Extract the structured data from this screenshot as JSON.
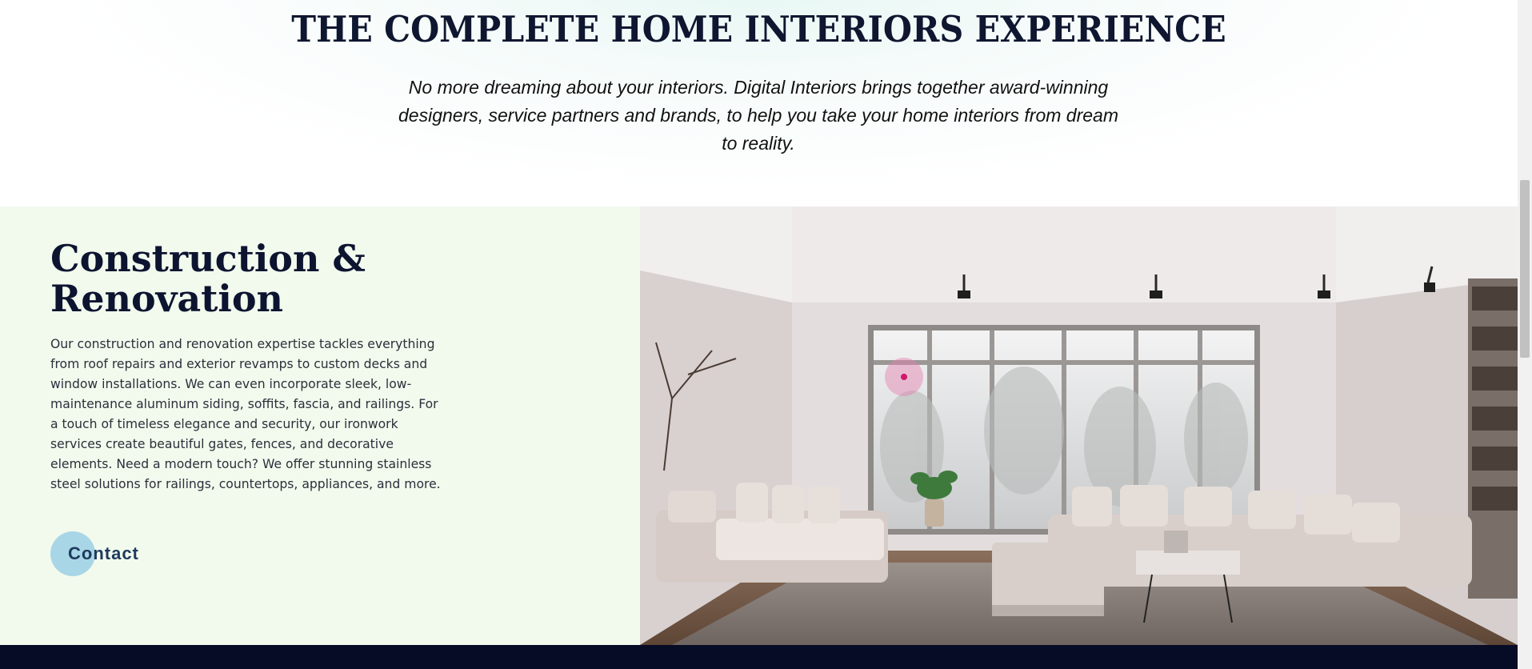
{
  "hero": {
    "title": "THE COMPLETE HOME INTERIORS EXPERIENCE",
    "description": "No more dreaming about your interiors. Digital Interiors brings together award-winning designers, service partners and brands, to help you take your home interiors from dream to reality."
  },
  "feature": {
    "title": "Construction & Renovation",
    "body": "Our construction and renovation expertise tackles everything from roof repairs and exterior revamps to custom decks and window installations. We can even incorporate sleek, low-maintenance aluminum siding, soffits, fascia, and railings. For a touch of timeless elegance and security, our ironwork services create beautiful gates, fences, and decorative elements. Need a modern touch? We offer stunning stainless steel solutions for railings, countertops, appliances, and more.",
    "contact_label": "Contact",
    "image_subject": "living-room-interior"
  },
  "colors": {
    "heading": "#0d1430",
    "feature_bg": "#f2faee",
    "button_circle": "#a8d6e6",
    "footer": "#060b26"
  }
}
